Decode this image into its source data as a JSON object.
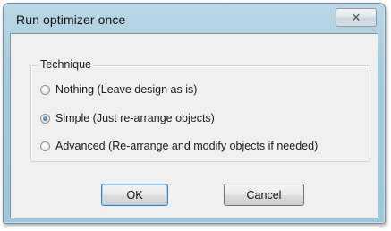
{
  "dialog": {
    "title": "Run optimizer once",
    "close_glyph": "✕"
  },
  "technique": {
    "label": "Technique",
    "options": [
      {
        "label": "Nothing (Leave design as is)",
        "checked": false
      },
      {
        "label": "Simple (Just re-arrange objects)",
        "checked": true
      },
      {
        "label": "Advanced (Re-arrange and modify objects if needed)",
        "checked": false
      }
    ]
  },
  "buttons": {
    "ok_label": "OK",
    "cancel_label": "Cancel"
  }
}
